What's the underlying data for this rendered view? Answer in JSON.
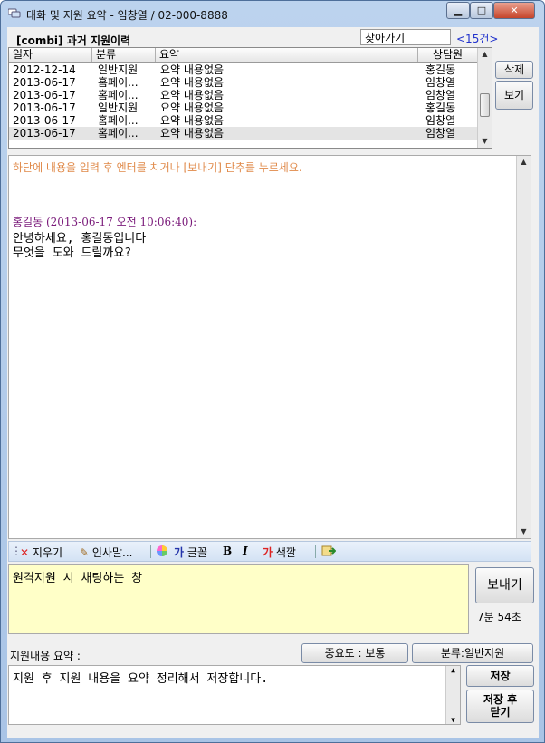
{
  "window": {
    "title": "대화 및 지원 요약 - 임창열 / 02-000-8888",
    "min_glyph": "▁",
    "max_glyph": "□",
    "close_glyph": "✕"
  },
  "history": {
    "title": "[combi] 과거 지원이력",
    "search_value": "찾아가기",
    "count": "<15건>",
    "columns": [
      "일자",
      "분류",
      "요약",
      "상담원"
    ],
    "rows": [
      [
        "2012-12-14",
        "일반지원",
        "요약 내용없음",
        "홍길동"
      ],
      [
        "2013-06-17",
        "홈페이...",
        "요약 내용없음",
        "임창열"
      ],
      [
        "2013-06-17",
        "홈페이...",
        "요약 내용없음",
        "임창열"
      ],
      [
        "2013-06-17",
        "일반지원",
        "요약 내용없음",
        "홍길동"
      ],
      [
        "2013-06-17",
        "홈페이...",
        "요약 내용없음",
        "임창열"
      ],
      [
        "2013-06-17",
        "홈페이...",
        "요약 내용없음",
        "임창열"
      ]
    ],
    "delete_label": "삭제",
    "view_label": "보기"
  },
  "chat": {
    "notice": "하단에 내용을 입력 후 엔터를 치거나 [보내기] 단추를 누르세요.",
    "message": {
      "sender": "홍길동",
      "timestamp": "(2013-06-17 오전 10:06:40):",
      "lines": [
        "안녕하세요, 홍길동입니다",
        "무엇을 도와 드릴까요?"
      ]
    }
  },
  "toolbar": {
    "clear": "지우기",
    "greeting": "인사말...",
    "font_glyph": "가",
    "font": "글꼴",
    "bold": "B",
    "italic": "I",
    "color_glyph": "가",
    "color": "색깔"
  },
  "compose": {
    "text": "원격지원 시 채팅하는 창",
    "send_label": "보내기",
    "timer": "7분 54초"
  },
  "summary": {
    "label": "지원내용 요약 :",
    "importance": "중요도 : 보통",
    "category": "분류:일반지원",
    "text": "지원 후 지원 내용을 요약 정리해서 저장합니다.",
    "save_label": "저장",
    "save_close_label": "저장 후\n닫기"
  },
  "colors": {
    "chat_sender": "#7a1a7a",
    "notice": "#e08a4a",
    "compose_bg": "#ffffc8",
    "link": "#2233cc"
  }
}
